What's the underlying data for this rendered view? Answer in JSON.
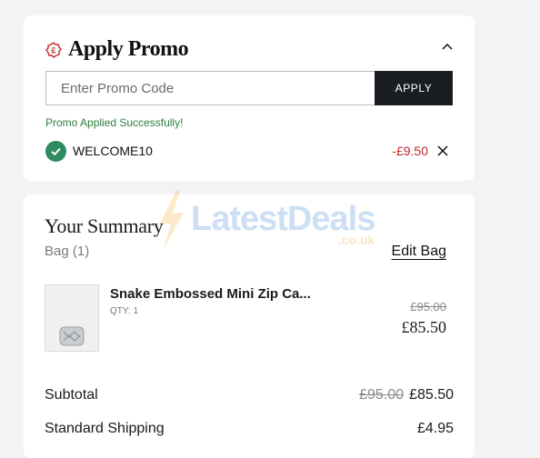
{
  "promo": {
    "title": "Apply Promo",
    "input_placeholder": "Enter Promo Code",
    "apply_label": "APPLY",
    "success_message": "Promo Applied Successfully!",
    "applied_code": "WELCOME10",
    "discount": "-£9.50"
  },
  "summary": {
    "title": "Your Summary",
    "bag_label": "Bag (1)",
    "edit_label": "Edit Bag",
    "item": {
      "name": "Snake Embossed Mini Zip Ca...",
      "qty": "QTY: 1",
      "was_price": "£95.00",
      "price": "£85.50"
    },
    "subtotal_label": "Subtotal",
    "subtotal_was": "£95.00",
    "subtotal_value": "£85.50",
    "shipping_label": "Standard Shipping",
    "shipping_value": "£4.95"
  },
  "watermark": {
    "brand": "LatestDeals",
    "suffix": ".co.uk"
  },
  "colors": {
    "accent_green": "#2f8c5f",
    "discount_red": "#c1272d",
    "button_dark": "#1a1e23"
  },
  "icons": [
    "promo-tag-icon",
    "chevron-up-icon",
    "check-icon",
    "close-icon"
  ]
}
